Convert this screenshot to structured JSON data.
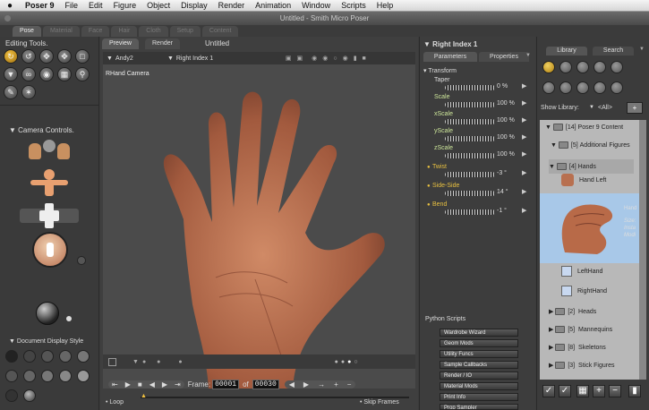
{
  "menubar": {
    "apple": "",
    "app": "Poser 9",
    "items": [
      "File",
      "Edit",
      "Figure",
      "Object",
      "Display",
      "Render",
      "Animation",
      "Window",
      "Scripts",
      "Help"
    ]
  },
  "window_title": "Untitled - Smith Micro Poser",
  "rooms": [
    "Pose",
    "Material",
    "Face",
    "Hair",
    "Cloth",
    "Setup",
    "Content"
  ],
  "left": {
    "editing_tools_title": "Editing Tools.",
    "camera_controls_title": "Camera Controls.",
    "doc_display_title": "Document Display Style"
  },
  "viewport": {
    "tab_preview": "Preview",
    "tab_render": "Render",
    "doc_title": "Untitled",
    "figure_select": "Andy2",
    "actor_select": "Right Index 1",
    "camera_label": "RHand Camera"
  },
  "timeline": {
    "frame_label": "Frame:",
    "frame_current": "00001",
    "of_label": "of",
    "frame_total": "00030",
    "loop_label": "Loop",
    "skip_frames_label": "Skip Frames"
  },
  "params": {
    "actor": "Right Index 1",
    "tab_parameters": "Parameters",
    "tab_properties": "Properties",
    "group": "Transform",
    "rows": [
      {
        "name": "Taper",
        "value": "0 %"
      },
      {
        "name": "Scale",
        "value": "100 %"
      },
      {
        "name": "xScale",
        "value": "100 %"
      },
      {
        "name": "yScale",
        "value": "100 %"
      },
      {
        "name": "zScale",
        "value": "100 %"
      },
      {
        "name": "Twist",
        "value": "-3 °"
      },
      {
        "name": "Side-Side",
        "value": "14 °"
      },
      {
        "name": "Bend",
        "value": "-1 °"
      }
    ],
    "python_title": "Python Scripts",
    "python_buttons": [
      "Wardrobe Wizard",
      "Geom Mods",
      "Utility Funcs",
      "Sample Callbacks",
      "Render / IO",
      "Material Mods",
      "Print Info",
      "Prop Sampler"
    ]
  },
  "library": {
    "tab_library": "Library",
    "tab_search": "Search",
    "show_label": "Show Library:",
    "show_value": "<All>",
    "items": [
      {
        "count": "[14]",
        "name": "Poser 9 Content"
      },
      {
        "count": "[5]",
        "name": "Additional Figures"
      },
      {
        "count": "[4]",
        "name": "Hands"
      },
      {
        "count": "",
        "name": "Hand Left"
      },
      {
        "count": "",
        "name": "LeftHand"
      },
      {
        "count": "",
        "name": "RightHand"
      },
      {
        "count": "[2]",
        "name": "Heads"
      },
      {
        "count": "[5]",
        "name": "Mannequins"
      },
      {
        "count": "[8]",
        "name": "Skeletons"
      },
      {
        "count": "[3]",
        "name": "Stick Figures"
      }
    ],
    "preview_label": "Hand",
    "preview_size": "Size:",
    "preview_l2": "Insta",
    "preview_l3": "Modi"
  },
  "colors": {
    "accent": "#f0c040",
    "selection": "#a8c8e8",
    "skin": "#b86a48"
  }
}
